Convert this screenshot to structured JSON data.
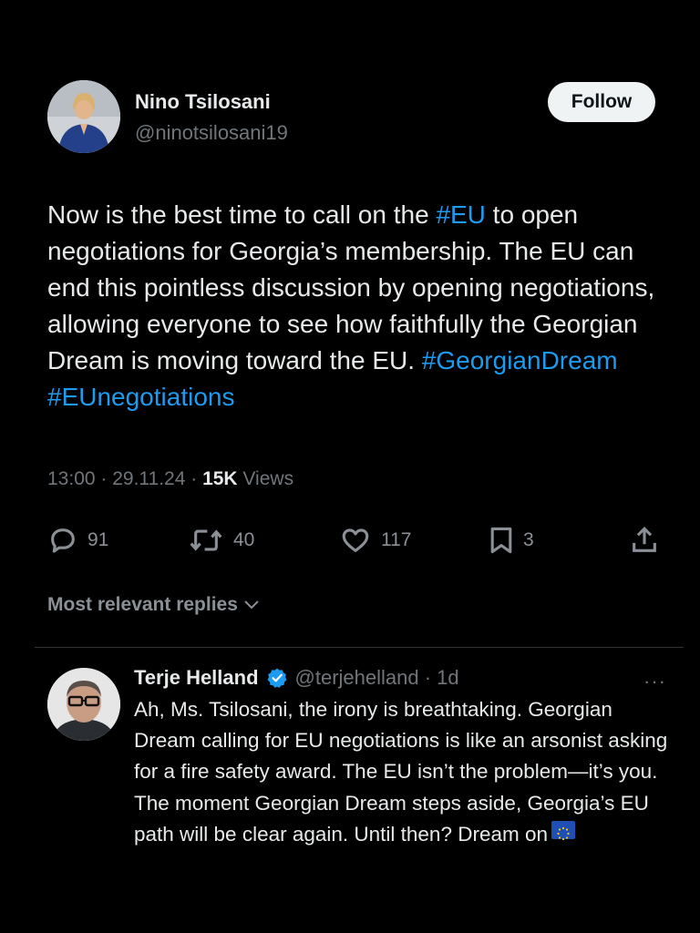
{
  "tweet": {
    "author_name": "Nino Tsilosani",
    "author_handle": "@ninotsilosani19",
    "follow_label": "Follow",
    "text_parts": {
      "p1": "Now is the best time to call on the ",
      "tag1": "#EU",
      "p2": " to open negotiations for Georgia’s membership. The EU can end this pointless discussion by opening negotiations, allowing everyone to see how faithfully the Georgian Dream is moving toward the EU. ",
      "tag2": "#GeorgianDream",
      "tag3": "#EUnegotiations"
    },
    "time": "13:00 · 29.11.24 · ",
    "views_count": "15K",
    "views_label": " Views",
    "stats": {
      "replies": "91",
      "reposts": "40",
      "likes": "117",
      "bookmarks": "3"
    }
  },
  "replies_section": {
    "label": "Most relevant replies"
  },
  "reply": {
    "author_name": "Terje Helland",
    "author_handle": "@terjehelland",
    "age": " · 1d",
    "more": "···",
    "text": "Ah, Ms. Tsilosani, the irony is breathtaking. Georgian Dream calling for EU negotiations is like an arsonist asking for a fire safety award. The EU isn’t the problem—it’s you.  The moment Georgian Dream steps aside, Georgia’s EU path will be clear again.  Until then? Dream on",
    "emoji": "eu-flag-icon"
  },
  "colors": {
    "background": "#000000",
    "text": "#e7e9ea",
    "muted": "#71767b",
    "link": "#1d9bf0",
    "verified": "#1d9bf0"
  }
}
